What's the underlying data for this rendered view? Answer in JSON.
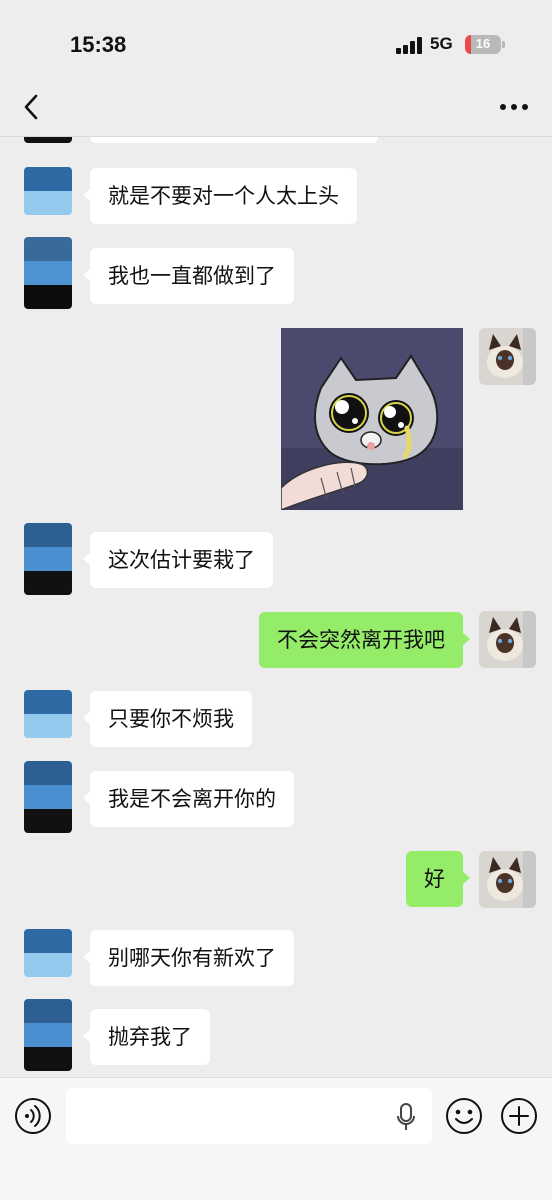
{
  "status_bar": {
    "time": "15:38",
    "network": "5G",
    "battery": "16"
  },
  "nav": {
    "back_icon": "chevron-left-icon",
    "more_icon": "ellipsis-icon"
  },
  "messages": [
    {
      "direction": "incoming",
      "type": "text",
      "text": "就是不要对一个人太上头"
    },
    {
      "direction": "incoming",
      "type": "text",
      "text": "我也一直都做到了"
    },
    {
      "direction": "outgoing",
      "type": "sticker",
      "sticker": "crying-cat-sticker"
    },
    {
      "direction": "incoming",
      "type": "text",
      "text": "这次估计要栽了"
    },
    {
      "direction": "outgoing",
      "type": "text",
      "text": "不会突然离开我吧"
    },
    {
      "direction": "incoming",
      "type": "text",
      "text": "只要你不烦我"
    },
    {
      "direction": "incoming",
      "type": "text",
      "text": "我是不会离开你的"
    },
    {
      "direction": "outgoing",
      "type": "text",
      "text": "好"
    },
    {
      "direction": "incoming",
      "type": "text",
      "text": "别哪天你有新欢了"
    },
    {
      "direction": "incoming",
      "type": "text",
      "text": "抛弃我了"
    }
  ],
  "input_bar": {
    "value": "",
    "icons": [
      "voice-icon",
      "mic-icon",
      "emoji-icon",
      "plus-icon"
    ]
  },
  "colors": {
    "background": "#ededed",
    "outgoing_bubble": "#95ec69",
    "incoming_bubble": "#ffffff",
    "battery_low": "#ec4a4a"
  }
}
